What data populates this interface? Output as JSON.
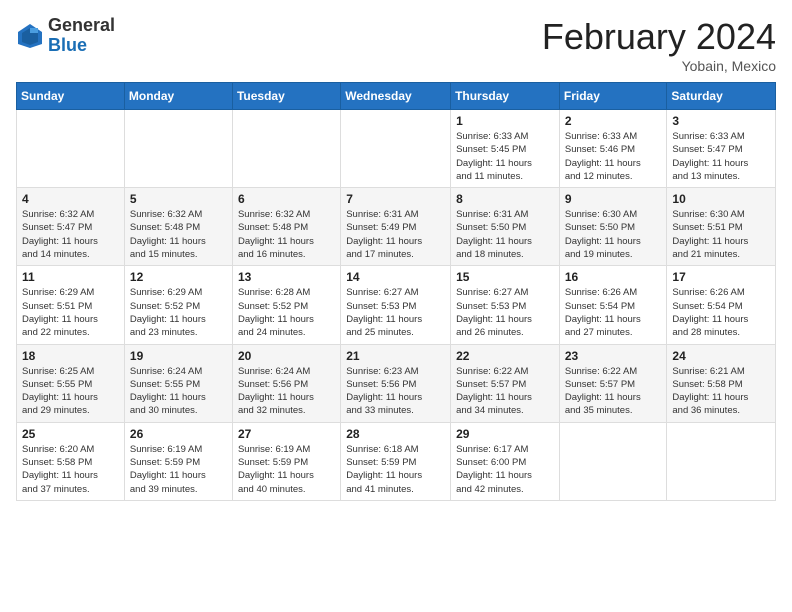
{
  "header": {
    "logo_general": "General",
    "logo_blue": "Blue",
    "month_title": "February 2024",
    "location": "Yobain, Mexico"
  },
  "weekdays": [
    "Sunday",
    "Monday",
    "Tuesday",
    "Wednesday",
    "Thursday",
    "Friday",
    "Saturday"
  ],
  "weeks": [
    [
      {
        "day": "",
        "info": ""
      },
      {
        "day": "",
        "info": ""
      },
      {
        "day": "",
        "info": ""
      },
      {
        "day": "",
        "info": ""
      },
      {
        "day": "1",
        "info": "Sunrise: 6:33 AM\nSunset: 5:45 PM\nDaylight: 11 hours\nand 11 minutes."
      },
      {
        "day": "2",
        "info": "Sunrise: 6:33 AM\nSunset: 5:46 PM\nDaylight: 11 hours\nand 12 minutes."
      },
      {
        "day": "3",
        "info": "Sunrise: 6:33 AM\nSunset: 5:47 PM\nDaylight: 11 hours\nand 13 minutes."
      }
    ],
    [
      {
        "day": "4",
        "info": "Sunrise: 6:32 AM\nSunset: 5:47 PM\nDaylight: 11 hours\nand 14 minutes."
      },
      {
        "day": "5",
        "info": "Sunrise: 6:32 AM\nSunset: 5:48 PM\nDaylight: 11 hours\nand 15 minutes."
      },
      {
        "day": "6",
        "info": "Sunrise: 6:32 AM\nSunset: 5:48 PM\nDaylight: 11 hours\nand 16 minutes."
      },
      {
        "day": "7",
        "info": "Sunrise: 6:31 AM\nSunset: 5:49 PM\nDaylight: 11 hours\nand 17 minutes."
      },
      {
        "day": "8",
        "info": "Sunrise: 6:31 AM\nSunset: 5:50 PM\nDaylight: 11 hours\nand 18 minutes."
      },
      {
        "day": "9",
        "info": "Sunrise: 6:30 AM\nSunset: 5:50 PM\nDaylight: 11 hours\nand 19 minutes."
      },
      {
        "day": "10",
        "info": "Sunrise: 6:30 AM\nSunset: 5:51 PM\nDaylight: 11 hours\nand 21 minutes."
      }
    ],
    [
      {
        "day": "11",
        "info": "Sunrise: 6:29 AM\nSunset: 5:51 PM\nDaylight: 11 hours\nand 22 minutes."
      },
      {
        "day": "12",
        "info": "Sunrise: 6:29 AM\nSunset: 5:52 PM\nDaylight: 11 hours\nand 23 minutes."
      },
      {
        "day": "13",
        "info": "Sunrise: 6:28 AM\nSunset: 5:52 PM\nDaylight: 11 hours\nand 24 minutes."
      },
      {
        "day": "14",
        "info": "Sunrise: 6:27 AM\nSunset: 5:53 PM\nDaylight: 11 hours\nand 25 minutes."
      },
      {
        "day": "15",
        "info": "Sunrise: 6:27 AM\nSunset: 5:53 PM\nDaylight: 11 hours\nand 26 minutes."
      },
      {
        "day": "16",
        "info": "Sunrise: 6:26 AM\nSunset: 5:54 PM\nDaylight: 11 hours\nand 27 minutes."
      },
      {
        "day": "17",
        "info": "Sunrise: 6:26 AM\nSunset: 5:54 PM\nDaylight: 11 hours\nand 28 minutes."
      }
    ],
    [
      {
        "day": "18",
        "info": "Sunrise: 6:25 AM\nSunset: 5:55 PM\nDaylight: 11 hours\nand 29 minutes."
      },
      {
        "day": "19",
        "info": "Sunrise: 6:24 AM\nSunset: 5:55 PM\nDaylight: 11 hours\nand 30 minutes."
      },
      {
        "day": "20",
        "info": "Sunrise: 6:24 AM\nSunset: 5:56 PM\nDaylight: 11 hours\nand 32 minutes."
      },
      {
        "day": "21",
        "info": "Sunrise: 6:23 AM\nSunset: 5:56 PM\nDaylight: 11 hours\nand 33 minutes."
      },
      {
        "day": "22",
        "info": "Sunrise: 6:22 AM\nSunset: 5:57 PM\nDaylight: 11 hours\nand 34 minutes."
      },
      {
        "day": "23",
        "info": "Sunrise: 6:22 AM\nSunset: 5:57 PM\nDaylight: 11 hours\nand 35 minutes."
      },
      {
        "day": "24",
        "info": "Sunrise: 6:21 AM\nSunset: 5:58 PM\nDaylight: 11 hours\nand 36 minutes."
      }
    ],
    [
      {
        "day": "25",
        "info": "Sunrise: 6:20 AM\nSunset: 5:58 PM\nDaylight: 11 hours\nand 37 minutes."
      },
      {
        "day": "26",
        "info": "Sunrise: 6:19 AM\nSunset: 5:59 PM\nDaylight: 11 hours\nand 39 minutes."
      },
      {
        "day": "27",
        "info": "Sunrise: 6:19 AM\nSunset: 5:59 PM\nDaylight: 11 hours\nand 40 minutes."
      },
      {
        "day": "28",
        "info": "Sunrise: 6:18 AM\nSunset: 5:59 PM\nDaylight: 11 hours\nand 41 minutes."
      },
      {
        "day": "29",
        "info": "Sunrise: 6:17 AM\nSunset: 6:00 PM\nDaylight: 11 hours\nand 42 minutes."
      },
      {
        "day": "",
        "info": ""
      },
      {
        "day": "",
        "info": ""
      }
    ]
  ]
}
